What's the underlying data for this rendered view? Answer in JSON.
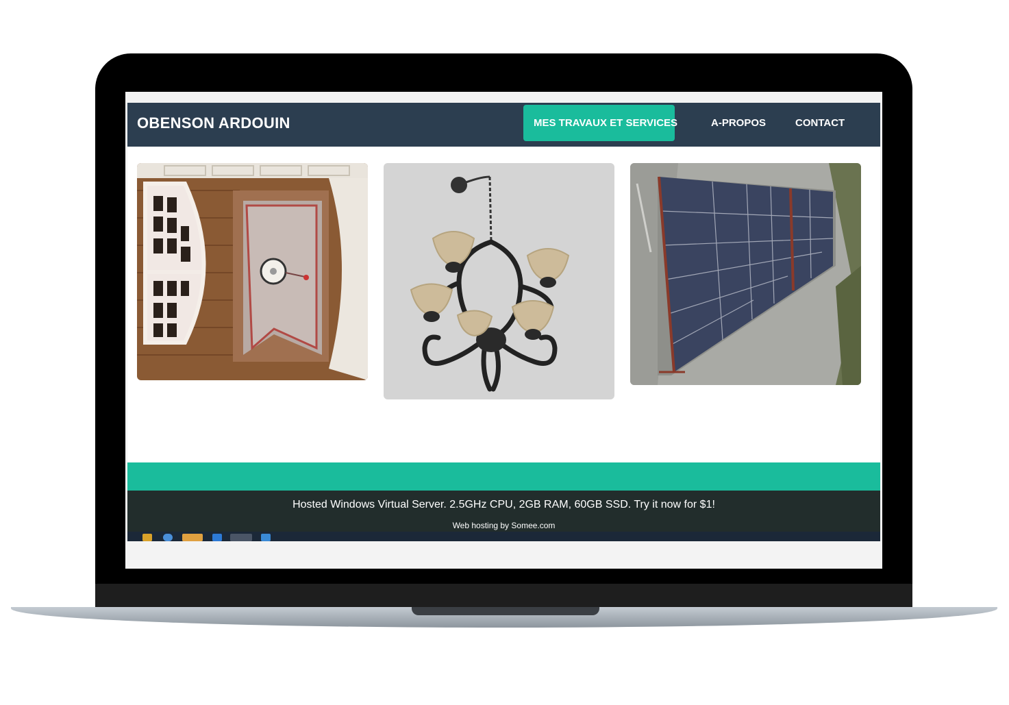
{
  "header": {
    "brand": "OBENSON ARDOUIN",
    "nav": [
      {
        "label": "MES TRAVAUX ET SERVICES",
        "active": true
      },
      {
        "label": "A-PROPOS",
        "active": false
      },
      {
        "label": "CONTACT",
        "active": false
      }
    ]
  },
  "gallery": {
    "items": [
      {
        "subject": "ceiling-window-photo"
      },
      {
        "subject": "chandelier-photo"
      },
      {
        "subject": "solar-panels-photo"
      }
    ]
  },
  "footer": {
    "ad_text": "Hosted Windows Virtual Server. 2.5GHz CPU, 2GB RAM, 60GB SSD. Try it now for $1!",
    "credit": "Web hosting by Somee.com"
  },
  "colors": {
    "nav_bg": "#2c3e50",
    "accent": "#1abc9c",
    "footer_bg": "#222d2c"
  }
}
